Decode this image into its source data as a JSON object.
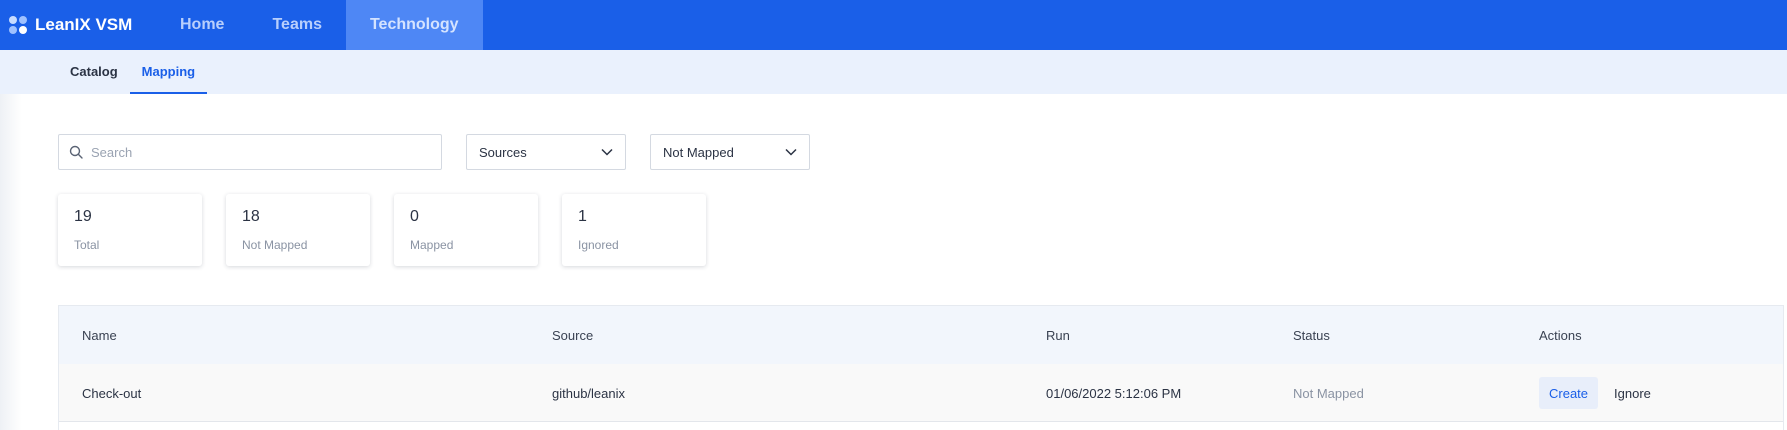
{
  "app": {
    "title": "LeanIX VSM"
  },
  "topnav": {
    "items": [
      {
        "label": "Home"
      },
      {
        "label": "Teams"
      },
      {
        "label": "Technology"
      }
    ]
  },
  "subnav": {
    "items": [
      {
        "label": "Catalog"
      },
      {
        "label": "Mapping"
      }
    ]
  },
  "filters": {
    "search_placeholder": "Search",
    "sources_selected": "Sources",
    "status_selected": "Not Mapped"
  },
  "stats": [
    {
      "value": "19",
      "label": "Total"
    },
    {
      "value": "18",
      "label": "Not Mapped"
    },
    {
      "value": "0",
      "label": "Mapped"
    },
    {
      "value": "1",
      "label": "Ignored"
    }
  ],
  "table": {
    "columns": [
      "Name",
      "Source",
      "Run",
      "Status",
      "Actions"
    ],
    "rows": [
      {
        "name": "Check-out",
        "source": "github/leanix",
        "run": "01/06/2022 5:12:06 PM",
        "status": "Not Mapped",
        "action_primary": "Create",
        "action_secondary": "Ignore"
      }
    ]
  },
  "colors": {
    "brand": "#1a5fe8",
    "nav_active": "#4e87f5",
    "subnav_bg": "#eaf1fd"
  }
}
